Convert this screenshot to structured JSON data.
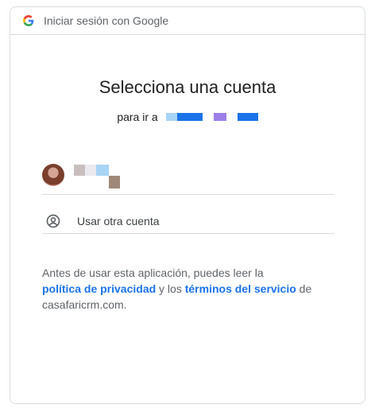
{
  "header": {
    "title": "Iniciar sesión con Google",
    "icon": "google-g-icon"
  },
  "main": {
    "title": "Selecciona una cuenta",
    "subtitle_prefix": "para ir a"
  },
  "accounts": [
    {
      "avatar_icon": "user-avatar"
    }
  ],
  "other_account": {
    "label": "Usar otra cuenta",
    "icon": "account-circle-icon"
  },
  "disclaimer": {
    "text_1": "Antes de usar esta aplicación, puedes leer la",
    "privacy_link": "política de privacidad",
    "text_2": " y los ",
    "terms_link": "términos del servicio",
    "text_3": " de",
    "text_4": "casafaricrm.com."
  },
  "colors": {
    "link": "#1a73e8",
    "border": "#dadce0",
    "text_primary": "#202124",
    "text_secondary": "#5f6368"
  }
}
